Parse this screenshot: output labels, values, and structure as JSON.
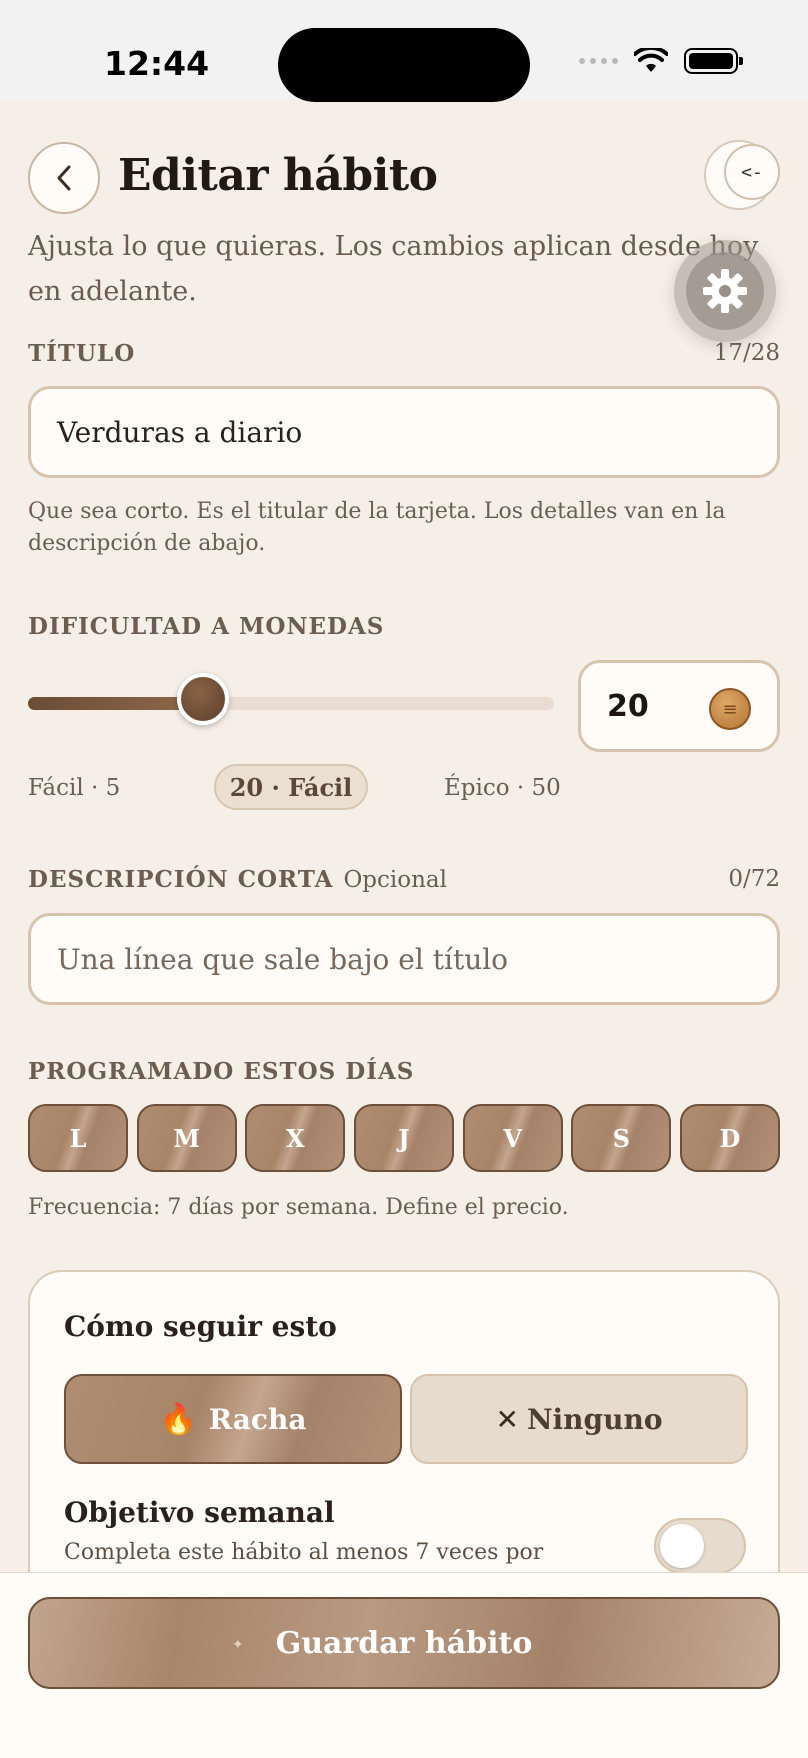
{
  "status_bar": {
    "time": "12:44"
  },
  "header": {
    "title": "Editar hábito",
    "back_icon": "chevron-left-icon",
    "corner_label": "<-"
  },
  "subtitle": "Ajusta lo que quieras. Los cambios aplican desde hoy en adelante.",
  "title_field": {
    "label": "TÍTULO",
    "counter": "17/28",
    "value": "Verduras a diario",
    "hint": "Que sea corto. Es el titular de la tarjeta. Los detalles van en la descripción de abajo."
  },
  "difficulty": {
    "label": "DIFICULTAD A MONEDAS",
    "value": "20",
    "level": 0.333,
    "min_label": "Fácil · 5",
    "current_label": "20 · Fácil",
    "max_label": "Épico · 50",
    "coin_icon": "coin-icon"
  },
  "description_field": {
    "label": "DESCRIPCIÓN CORTA",
    "optional": "Opcional",
    "counter": "0/72",
    "placeholder": "Una línea que sale bajo el título"
  },
  "schedule": {
    "label": "PROGRAMADO ESTOS DÍAS",
    "days": [
      "L",
      "M",
      "X",
      "J",
      "V",
      "S",
      "D"
    ],
    "summary": "Frecuencia: 7 días por semana. Define el precio."
  },
  "tracking": {
    "title": "Cómo seguir esto",
    "option_streak": "Racha",
    "option_none": "Ninguno",
    "weekly_goal_title": "Objetivo semanal",
    "weekly_goal_desc": "Completa este hábito al menos 7 veces por"
  },
  "save_label": "Guardar hábito",
  "colors": {
    "accent": "#a9856a",
    "background": "#f5efe7",
    "dark": "#6d4f3a"
  }
}
